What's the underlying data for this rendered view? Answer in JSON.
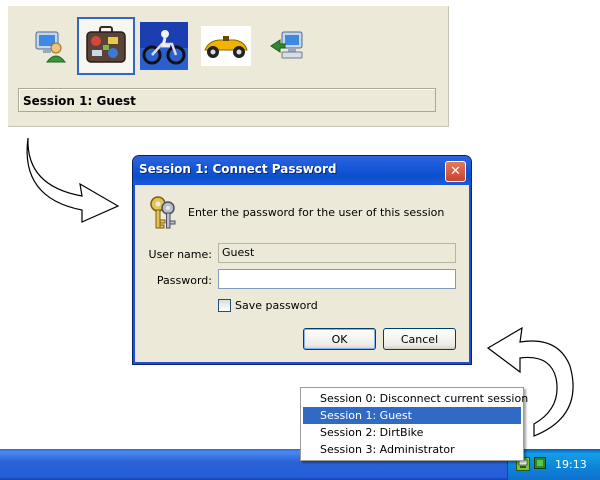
{
  "user_panel": {
    "tiles": [
      "computer-user-icon",
      "suitcase-icon",
      "dirtbike-icon",
      "race-car-icon",
      "computer-transfer-icon"
    ],
    "selected_index": 1,
    "session_label": "Session 1: Guest"
  },
  "dialog": {
    "title": "Session 1: Connect Password",
    "close_symbol": "✕",
    "prompt": "Enter the password for the user of this session",
    "username_label": "User name:",
    "username_value": "Guest",
    "password_label": "Password:",
    "password_value": "",
    "save_password_label": "Save password",
    "save_password_checked": false,
    "ok_label": "OK",
    "cancel_label": "Cancel"
  },
  "context_menu": {
    "items": [
      "Session 0: Disconnect current session",
      "Session 1: Guest",
      "Session 2: DirtBike",
      "Session 3: Administrator"
    ],
    "highlighted_index": 1
  },
  "taskbar": {
    "clock": "19:13"
  },
  "colors": {
    "title_bar": "#0a4fcc",
    "menu_highlight": "#316ac5",
    "panel_bg": "#ece9d8"
  }
}
